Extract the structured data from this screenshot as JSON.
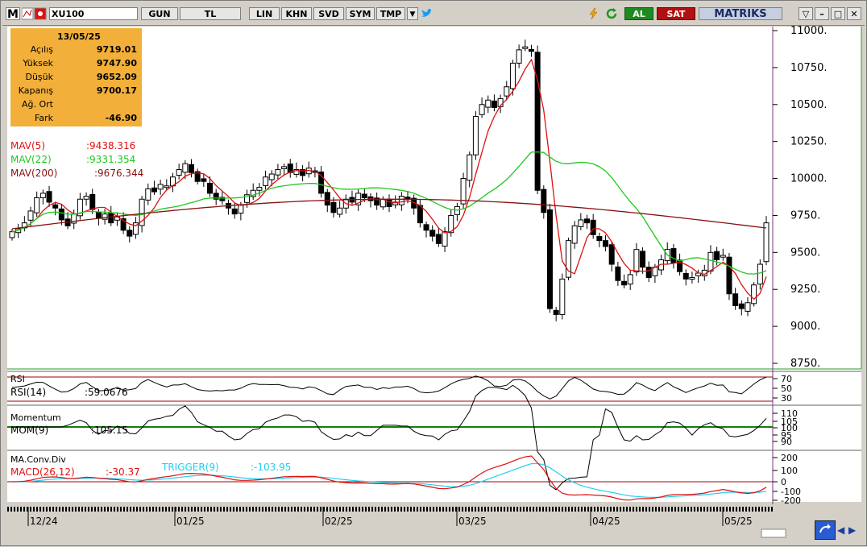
{
  "toolbar": {
    "logo_letter": "M",
    "symbol": "XU100",
    "buttons": [
      "GUN",
      "TL",
      "LIN",
      "KHN",
      "SVD",
      "SYM",
      "TMP"
    ],
    "buy_label": "AL",
    "sell_label": "SAT",
    "brand": "MATRIKS"
  },
  "info": {
    "date": "13/05/25",
    "rows": [
      {
        "label": "Açılış",
        "value": "9719.01"
      },
      {
        "label": "Yüksek",
        "value": "9747.90"
      },
      {
        "label": "Düşük",
        "value": "9652.09"
      },
      {
        "label": "Kapanış",
        "value": "9700.17"
      },
      {
        "label": "Ağ. Ort",
        "value": ""
      },
      {
        "label": "Fark",
        "value": "-46.90"
      }
    ]
  },
  "legend": {
    "mav5": {
      "label": "MAV(5)",
      "value": ":9438.316",
      "color": "#e01010"
    },
    "mav22": {
      "label": "MAV(22)",
      "value": ":9331.354",
      "color": "#1ec81e"
    },
    "mav200": {
      "label": "MAV(200)",
      "value": ":9676.344",
      "color": "#8a1010"
    }
  },
  "chart_data": [
    {
      "type": "candlestick",
      "title": "XU100",
      "y_ticks": [
        "11000.",
        "10750.",
        "10500.",
        "10250.",
        "10000.",
        "9750.",
        "9500.",
        "9250.",
        "9000.",
        "8750."
      ],
      "ylim": [
        8750,
        11000
      ],
      "x_ticks": [
        "12/24",
        "01/25",
        "02/25",
        "03/25",
        "04/25",
        "05/25"
      ],
      "ohlc_last": {
        "date": "13/05/25",
        "open": 9719.01,
        "high": 9747.9,
        "low": 9652.09,
        "close": 9700.17
      },
      "series": [
        {
          "name": "MAV(5)",
          "last": 9438.316
        },
        {
          "name": "MAV(22)",
          "last": 9331.354
        },
        {
          "name": "MAV(200)",
          "last": 9676.344
        }
      ]
    },
    {
      "type": "line",
      "title": "RSI",
      "series": [
        {
          "name": "RSI(14)",
          "last": 59.0676
        }
      ],
      "y_ticks": [
        "70",
        "50",
        "30"
      ]
    },
    {
      "type": "line",
      "title": "Momentum",
      "series": [
        {
          "name": "MOM(9)",
          "last": 105.15
        }
      ],
      "y_ticks": [
        "110",
        "105",
        "100",
        "95",
        "90"
      ]
    },
    {
      "type": "line",
      "title": "MA.Conv.Div",
      "series": [
        {
          "name": "MACD(26,12)",
          "last": -30.37
        },
        {
          "name": "TRIGGER(9)",
          "last": -103.95
        }
      ],
      "y_ticks": [
        "200",
        "100",
        "0",
        "-100",
        "-200"
      ]
    }
  ],
  "panels": {
    "rsi": {
      "title": "RSI",
      "label": "RSI(14)",
      "value": ":59.0676"
    },
    "mom": {
      "title": "Momentum",
      "label": "MOM(9)",
      "value": ":105.15"
    },
    "macd": {
      "title": "MA.Conv.Div",
      "label": "MACD(26,12)",
      "value": ":-30.37",
      "trigger_label": "TRIGGER(9)",
      "trigger_value": ":-103.95"
    }
  },
  "colors": {
    "mav5": "#e01010",
    "mav22": "#1ec81e",
    "mav200": "#8a1010",
    "trigger": "#20d0f0",
    "macd": "#e01010",
    "infobox": "#f2b03a"
  }
}
